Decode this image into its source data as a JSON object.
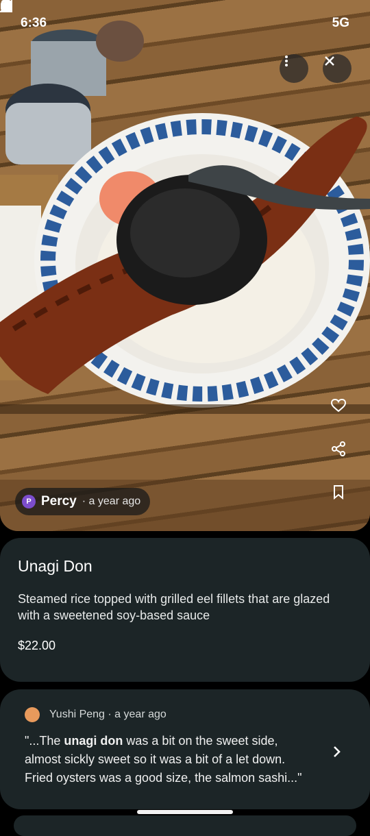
{
  "status_bar": {
    "time": "6:36",
    "network": "5G",
    "icons": [
      "instagram-icon",
      "diamond-icon",
      "notification-icon",
      "download-icon",
      "dot-icon",
      "location-icon",
      "signal-icon",
      "battery-icon"
    ]
  },
  "photo": {
    "subject": "unagi-don-bowl",
    "author": {
      "initial": "P",
      "name": "Percy",
      "time": "· a year ago"
    }
  },
  "actions": {
    "more": "more-vert-icon",
    "close": "close-icon",
    "like": "heart-icon",
    "share": "share-icon",
    "save": "bookmark-icon"
  },
  "dish": {
    "title": "Unagi Don",
    "description": "Steamed rice topped with grilled eel fillets that are glazed with a sweetened soy-based sauce",
    "price": "$22.00"
  },
  "review": {
    "author": "Yushi Peng",
    "time": "· a year ago",
    "text_before": "\"...The ",
    "highlight": "unagi don",
    "text_after": " was a bit on the sweet side, almost sickly sweet so it was a bit of a let down. Fried oysters was a good size, the salmon sashi...\""
  },
  "colors": {
    "card_bg": "#1c2527",
    "background": "#000000",
    "avatar_p": "#7c4dcc"
  }
}
